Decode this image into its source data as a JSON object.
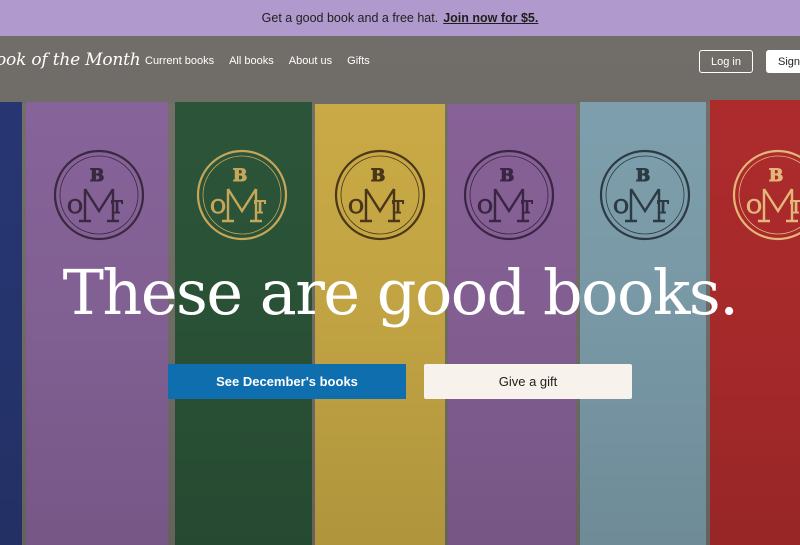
{
  "promo": {
    "text": "Get a good book and a free hat.",
    "link": "Join now for $5."
  },
  "nav": {
    "logo": "ook of the Month",
    "links": [
      "Current books",
      "All books",
      "About us",
      "Gifts"
    ],
    "login": "Log in",
    "signup": "Sign"
  },
  "hero": {
    "headline": "These are good books.",
    "primary_cta": "See December's books",
    "secondary_cta": "Give a gift",
    "seal_letters": [
      "B",
      "O",
      "T",
      "M"
    ],
    "spine_colors": [
      "#2a3a7a",
      "#8f6aa3",
      "#2e5a3c",
      "#d6b54a",
      "#9068a1",
      "#86a9b8",
      "#b92e2f"
    ]
  },
  "colors": {
    "promo_bg": "#b09acd",
    "primary_button": "#0f6fae",
    "secondary_button": "#f7f2ec"
  }
}
